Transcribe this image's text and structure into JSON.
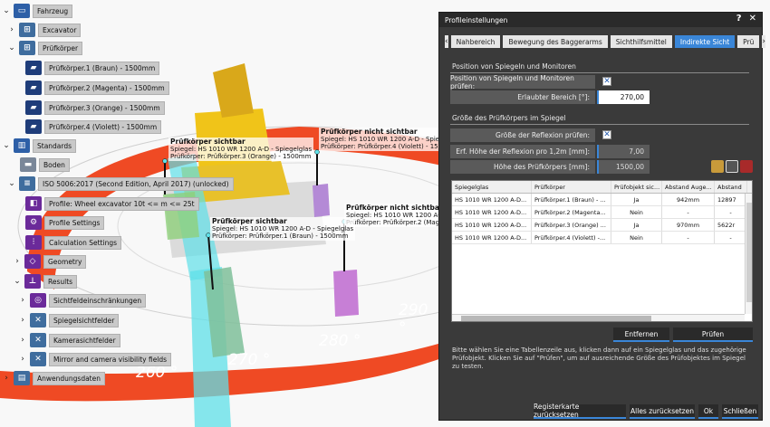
{
  "tree": {
    "items": [
      {
        "label": "Fahrzeug",
        "chev": "⌄",
        "icon": "vehicle-icon"
      },
      {
        "label": "Excavator",
        "chev": "›",
        "icon": "hierarchy-icon"
      },
      {
        "label": "Prüfkörper",
        "chev": "⌄",
        "icon": "hierarchy-icon"
      },
      {
        "label": "Prüfkörper.1 (Braun) - 1500mm",
        "chev": "",
        "icon": "test-body-icon"
      },
      {
        "label": "Prüfkörper.2 (Magenta) - 1500mm",
        "chev": "",
        "icon": "test-body-icon"
      },
      {
        "label": "Prüfkörper.3 (Orange) - 1500mm",
        "chev": "",
        "icon": "test-body-icon"
      },
      {
        "label": "Prüfkörper.4 (Violett) - 1500mm",
        "chev": "",
        "icon": "test-body-icon"
      },
      {
        "label": "Standards",
        "chev": "⌄",
        "icon": "standards-icon"
      },
      {
        "label": "Boden",
        "chev": "",
        "icon": "ground-icon"
      },
      {
        "label": "ISO 5006:2017 (Second Edition, April 2017) (unlocked)",
        "chev": "⌄",
        "icon": "iso-icon"
      },
      {
        "label": "Profile: Wheel excavator 10t <= m <= 25t",
        "chev": "",
        "icon": "profile-icon"
      },
      {
        "label": "Profile Settings",
        "chev": "",
        "icon": "profile-settings-icon"
      },
      {
        "label": "Calculation Settings",
        "chev": "",
        "icon": "calculation-settings-icon"
      },
      {
        "label": "Geometry",
        "chev": "›",
        "icon": "geometry-icon"
      },
      {
        "label": "Results",
        "chev": "⌄",
        "icon": "results-icon"
      },
      {
        "label": "Sichtfeldeinschränkungen",
        "chev": "›",
        "icon": "visibility-restriction-icon"
      },
      {
        "label": "Spiegelsichtfelder",
        "chev": "›",
        "icon": "mirror-field-icon"
      },
      {
        "label": "Kamerasichtfelder",
        "chev": "›",
        "icon": "camera-field-icon"
      },
      {
        "label": "Mirror and camera visibility fields",
        "chev": "›",
        "icon": "mirror-camera-field-icon"
      },
      {
        "label": "Anwendungsdaten",
        "chev": "›",
        "icon": "application-data-icon"
      }
    ]
  },
  "scene": {
    "annotations": [
      {
        "title": "Prüfkörper sichtbar",
        "line1": "Spiegel: HS 1010 WR 1200 A-D - Spiegelglas",
        "line2": "Prüfkörper: Prüfkörper.3 (Orange) - 1500mm"
      },
      {
        "title": "Prüfkörper nicht sichtbar",
        "line1": "Spiegel: HS 1010 WR 1200 A-D - Spiegelglas",
        "line2": "Prüfkörper: Prüfkörper.4 (Violett) - 1500mm"
      },
      {
        "title": "Prüfkörper nicht sichtbar",
        "line1": "Spiegel: HS 1010 WR 1200 A-D - Spiegel",
        "line2": "Prüfkörper: Prüfkörper.2 (Magen"
      },
      {
        "title": "Prüfkörper sichtbar",
        "line1": "Spiegel: HS 1010 WR 1200 A-D - Spiegelglas",
        "line2": "Prüfkörper: Prüfkörper.1 (Braun) - 1500mm"
      }
    ],
    "degrees": [
      "260 °",
      "270 °",
      "280 °",
      "290 °"
    ]
  },
  "dialog": {
    "title": "Profileinstellungen",
    "help": "?",
    "close": "✕",
    "tabs": [
      "Nahbereich",
      "Bewegung des Baggerarms",
      "Sichthilfsmittel",
      "Indirekte Sicht",
      "Prü"
    ],
    "active_tab": "Indirekte Sicht",
    "section1": "Position von Spiegeln und Monitoren",
    "check_position_label": "Position von Spiegeln und Monitoren prüfen:",
    "check_mark": "✕",
    "allowed_range_label": "Erlaubter Bereich [°]:",
    "allowed_range_value": "270,00",
    "section2": "Größe des Prüfkörpers im Spiegel",
    "check_reflection_label": "Größe der Reflexion prüfen:",
    "req_height_label": "Erf. Höhe der Reflexion pro 1,2m [mm]:",
    "req_height_value": "7,00",
    "body_height_label": "Höhe des Prüfkörpers [mm]:",
    "body_height_value": "1500,00",
    "table": {
      "columns": [
        "Spiegelglas",
        "Prüfkörper",
        "Prüfobjekt sic...",
        "Abstand Auge...",
        "Abstand"
      ],
      "rows": [
        [
          "HS 1010 WR 1200 A-D...",
          "Prüfkörper.1 (Braun) - ...",
          "Ja",
          "942mm",
          "12897"
        ],
        [
          "HS 1010 WR 1200 A-D...",
          "Prüfkörper.2 (Magenta...",
          "Nein",
          "-",
          "-"
        ],
        [
          "HS 1010 WR 1200 A-D...",
          "Prüfkörper.3 (Orange) ...",
          "Ja",
          "970mm",
          "5622r"
        ],
        [
          "HS 1010 WR 1200 A-D...",
          "Prüfkörper.4 (Violett) -...",
          "Nein",
          "-",
          "-"
        ]
      ]
    },
    "remove_button": "Entfernen",
    "check_button": "Prüfen",
    "hint": "Bitte wählen Sie eine Tabellenzeile aus, klicken dann auf ein Spiegelglas und das zugehörige Prüfobjekt. Klicken Sie auf \"Prüfen\", um auf ausreichende Größe des Prüfobjektes im Spiegel zu testen.",
    "footer": {
      "reset_tab": "Registerkarte zurücksetzen",
      "reset_all": "Alles zurücksetzen",
      "ok": "Ok",
      "close": "Schließen"
    }
  },
  "colors": {
    "accent": "#3a86d8",
    "ring": "#ef4a24",
    "cyan": "#5fe0e8",
    "magenta": "#c77fd6"
  }
}
